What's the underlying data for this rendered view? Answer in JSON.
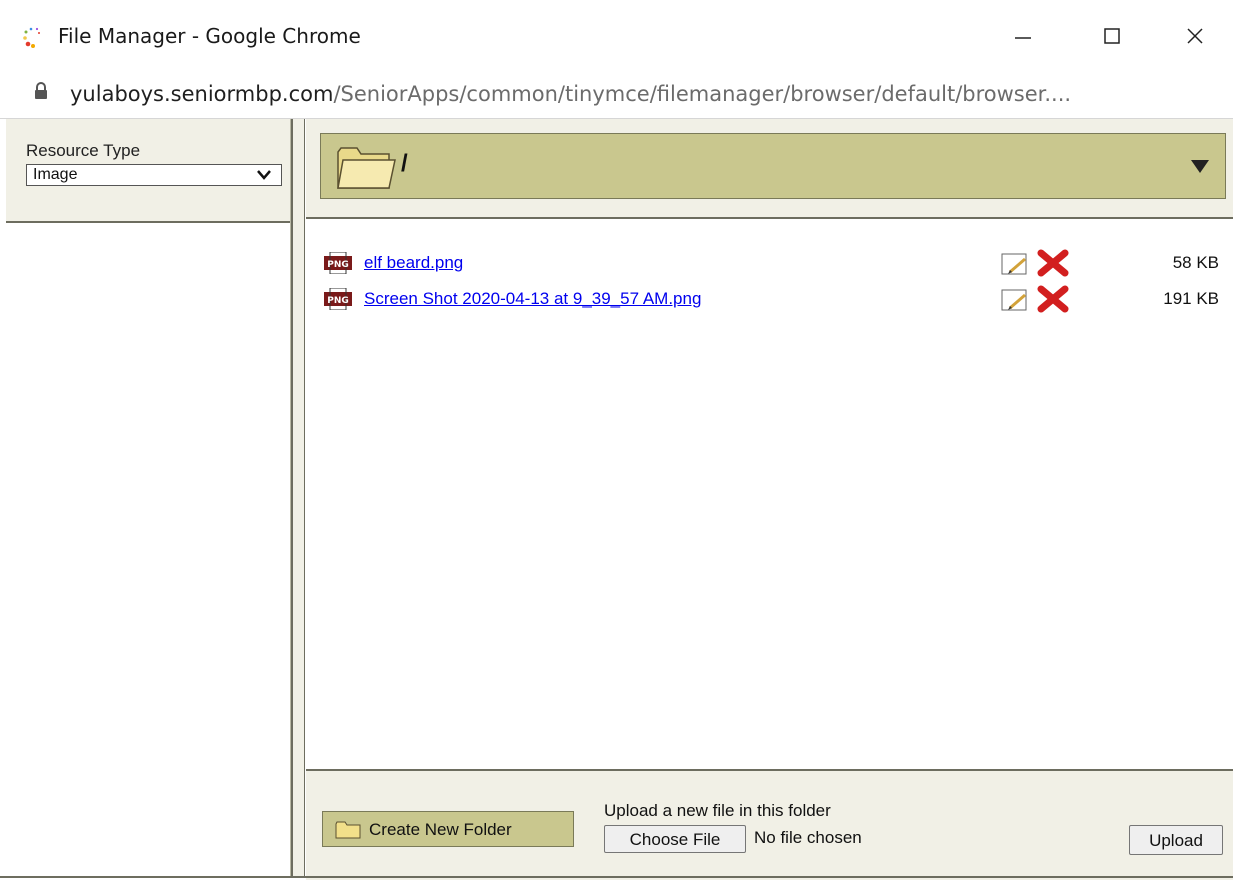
{
  "window": {
    "title": "File Manager - Google Chrome",
    "address_domain": "yulaboys.seniormbp.com",
    "address_path": "/SeniorApps/common/tinymce/filemanager/browser/default/browser...."
  },
  "sidebar": {
    "resource_type_label": "Resource Type",
    "resource_type_value": "Image"
  },
  "folder": {
    "current_path": "/"
  },
  "files": [
    {
      "name": "elf beard.png",
      "size": "58 KB",
      "icon": "png-file-icon"
    },
    {
      "name": "Screen Shot 2020-04-13 at 9_39_57 AM.png",
      "size": "191 KB",
      "icon": "png-file-icon"
    }
  ],
  "footer": {
    "create_folder_label": "Create New Folder",
    "upload_label": "Upload a new file in this folder",
    "choose_file_label": "Choose File",
    "no_file_text": "No file chosen",
    "upload_button_label": "Upload"
  },
  "colors": {
    "panel_bg": "#f1f0e6",
    "accent_bar": "#c9c78e",
    "link": "#0000ee",
    "delete_red": "#d21f1f"
  }
}
